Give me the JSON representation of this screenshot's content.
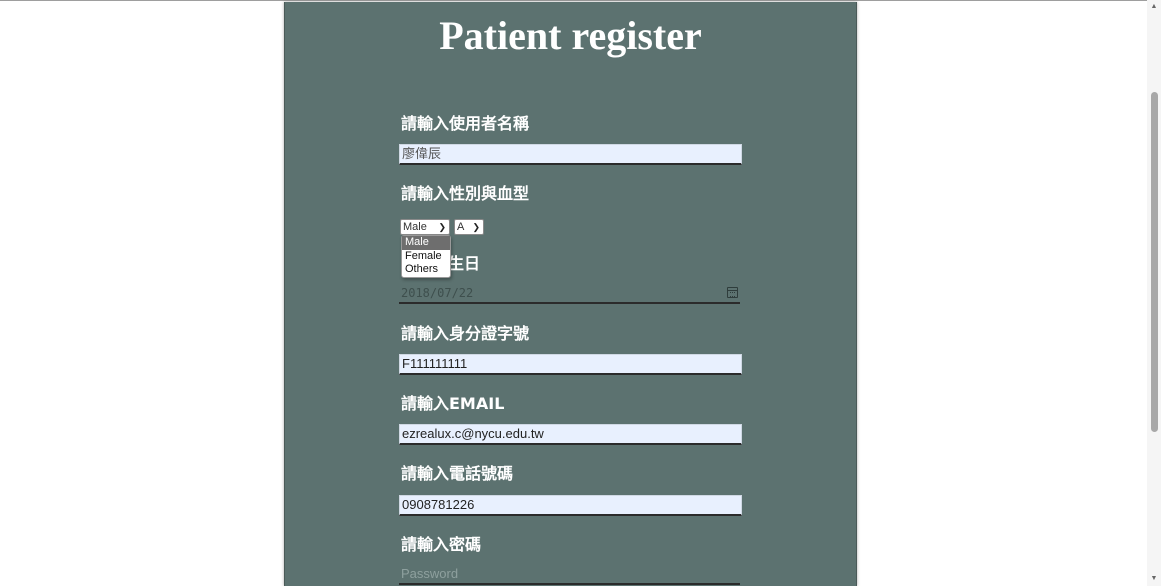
{
  "page": {
    "title": "Patient register"
  },
  "form": {
    "username": {
      "label": "請輸入使用者名稱",
      "value": "廖偉辰"
    },
    "gender_blood": {
      "label": "請輸入性別與血型",
      "gender_selected": "Male",
      "gender_options": [
        "Male",
        "Female",
        "Others"
      ],
      "blood_selected": "A"
    },
    "birthday": {
      "label_visible": "生日",
      "value": "2018/07/22"
    },
    "id_number": {
      "label": "請輸入身分證字號",
      "value": "F111111111"
    },
    "email": {
      "label": "請輸入EMAIL",
      "value": "ezrealux.c@nycu.edu.tw"
    },
    "phone": {
      "label": "請輸入電話號碼",
      "value": "0908781226"
    },
    "password": {
      "label": "請輸入密碼",
      "placeholder": "Password"
    }
  },
  "colors": {
    "panel_bg": "#5c7270",
    "field_bg": "#e8f0fe",
    "text_white": "#ffffff"
  },
  "icons": {
    "calendar": "calendar-icon",
    "select_chevron": "chevron-down-icon"
  }
}
